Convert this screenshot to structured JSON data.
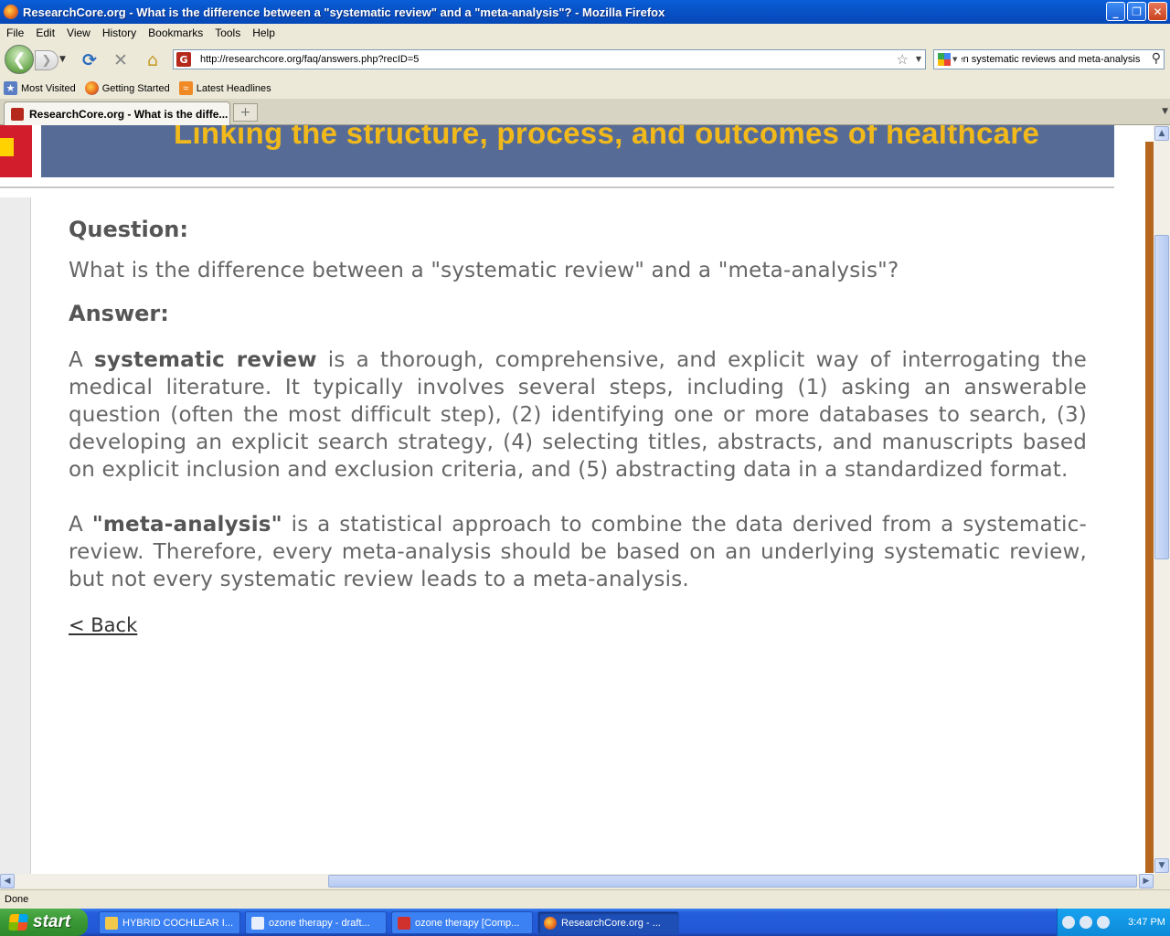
{
  "window": {
    "title": "ResearchCore.org - What is the difference between a \"systematic review\" and a \"meta-analysis\"? - Mozilla Firefox",
    "buttons": [
      "_",
      "❐",
      "✕"
    ]
  },
  "menubar": [
    "File",
    "Edit",
    "View",
    "History",
    "Bookmarks",
    "Tools",
    "Help"
  ],
  "navbar": {
    "url": "http://researchcore.org/faq/answers.php?recID=5",
    "search_query": "en systematic reviews and meta-analysis"
  },
  "bookmarks": [
    {
      "label": "Most Visited",
      "icon": "most-visited-icon"
    },
    {
      "label": "Getting Started",
      "icon": "firefox-icon"
    },
    {
      "label": "Latest Headlines",
      "icon": "rss-icon"
    }
  ],
  "tabs": [
    {
      "label": "ResearchCore.org - What is the diffe...",
      "active": true
    }
  ],
  "page": {
    "tagline": "Linking the structure, process, and outcomes of healthcare",
    "question_heading": "Question:",
    "question": "What is the difference between a \"systematic review\" and a \"meta-analysis\"?",
    "answer_heading": "Answer:",
    "para1": {
      "lead": "A ",
      "term": "systematic review",
      "body": " is a thorough, comprehensive, and explicit way of interrogating the medical literature. It typically involves several steps, including (1) asking an answerable question (often the most difficult step), (2) identifying one or more databases to search, (3) developing an explicit search strategy, (4) selecting titles, abstracts, and manuscripts based on explicit inclusion and exclusion criteria, and (5) abstracting data in a standardized format."
    },
    "para2": {
      "lead": "A ",
      "term": "\"meta-analysis\"",
      "body": " is a statistical approach to combine the data derived from a systematic-review. Therefore, every meta-analysis should be based on an underlying systematic review, but not every systematic review leads to a meta-analysis."
    },
    "back_link": "< Back"
  },
  "status": "Done",
  "taskbar": {
    "start": "start",
    "tasks": [
      {
        "label": "HYBRID COCHLEAR I...",
        "icon": "folder-icon",
        "active": false
      },
      {
        "label": "ozone therapy - draft...",
        "icon": "word-icon",
        "active": false
      },
      {
        "label": "ozone therapy [Comp...",
        "icon": "acrobat-icon",
        "active": false
      },
      {
        "label": "ResearchCore.org - ...",
        "icon": "firefox-icon",
        "active": true
      }
    ],
    "clock": "3:47 PM"
  },
  "colors": {
    "banner": "#566c97",
    "tagline": "#f2b91a",
    "accent_red": "#d11d2c"
  }
}
